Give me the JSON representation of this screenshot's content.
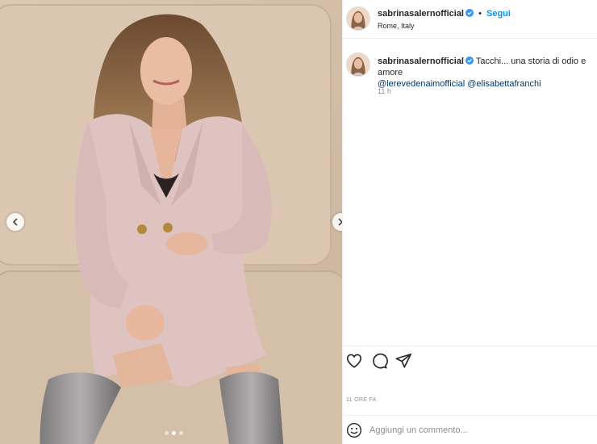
{
  "post": {
    "username": "sabrinasalernofficial",
    "separator": "•",
    "follow_label": "Segui",
    "location": "Rome, Italy"
  },
  "caption": {
    "username": "sabrinasalernofficial",
    "text": " Tacchi... una storia di odio e amore",
    "mentions": [
      "@lerevedenaimofficial",
      "@elisabettafranchi"
    ],
    "time_ago": "11 h"
  },
  "actions": {
    "icons": [
      "heart-icon",
      "comment-icon",
      "share-icon"
    ]
  },
  "post_time": "11 ORE FA",
  "comment_box": {
    "placeholder": "Aggiungi un commento..."
  },
  "carousel": {
    "slide_count": 3,
    "active_index": 1
  },
  "colors": {
    "link_blue": "#0095f6",
    "mention_blue": "#00376b",
    "verified_blue": "#3897f0",
    "secondary_text": "#8e8e8e"
  }
}
